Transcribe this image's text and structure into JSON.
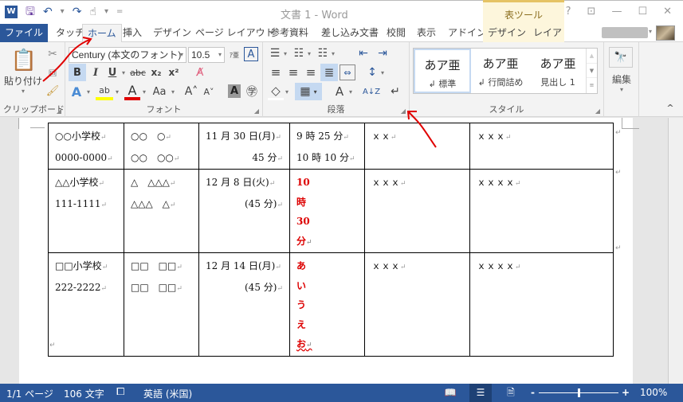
{
  "window": {
    "title": "文書 1 - Word",
    "context_tab_group": "表ツール",
    "controls": {
      "help": "?",
      "ribbon_display": "⊡",
      "minimize": "—",
      "maximize": "☐",
      "close": "✕"
    }
  },
  "qat": {
    "app_icon": "W",
    "save": "🖫",
    "undo": "↶",
    "undo_dd": "▾",
    "redo": "↷",
    "touch": "☝",
    "touch_dd": "▾",
    "customize": "="
  },
  "tabs": [
    {
      "label": "ファイル"
    },
    {
      "label": "タッチ"
    },
    {
      "label": "ホーム",
      "active": true
    },
    {
      "label": "挿入"
    },
    {
      "label": "デザイン"
    },
    {
      "label": "ページ レイアウト"
    },
    {
      "label": "参考資料"
    },
    {
      "label": "差し込み文書"
    },
    {
      "label": "校閲"
    },
    {
      "label": "表示"
    },
    {
      "label": "アドイン"
    },
    {
      "label": "デザイン",
      "context": true
    },
    {
      "label": "レイアウト",
      "context": true
    }
  ],
  "ribbon": {
    "clipboard": {
      "label": "クリップボード",
      "paste": "貼り付け",
      "paste_dd": "▾",
      "cut": "✂",
      "copy": "⧉",
      "format_painter": "🖌"
    },
    "font": {
      "label": "フォント",
      "font_name": "Century (本文のフォント)",
      "font_size": "10.5",
      "phonetic": "ｱ亜",
      "char_border": "A",
      "bold": "B",
      "italic": "I",
      "underline": "U",
      "strike": "abc",
      "subscript": "x₂",
      "superscript": "x²",
      "clear_format": "A̸",
      "text_effect": "A",
      "highlight": "ab",
      "highlight_color": "#ffff00",
      "font_color": "A",
      "font_color_value": "#e00000",
      "change_case": "Aa",
      "grow": "A˄",
      "shrink": "A˅",
      "char_shading": "A",
      "enclose": "㊫"
    },
    "paragraph": {
      "label": "段落",
      "bullets": "☰",
      "numbering": "☷",
      "multilevel": "☷",
      "dec_indent": "⇤",
      "inc_indent": "⇥",
      "align_left": "≡",
      "align_center": "≡",
      "align_right": "≡",
      "justify": "≣",
      "distributed": "⇔",
      "line_spacing": "↕",
      "shading": "◇",
      "borders": "▦",
      "asian_layout": "A",
      "sort": "A↓Z",
      "show_marks": "↵"
    },
    "styles": {
      "label": "スタイル",
      "items": [
        {
          "sample": "あア亜",
          "name": "↲ 標準"
        },
        {
          "sample": "あア亜",
          "name": "↲ 行間詰め"
        },
        {
          "sample": "あア亜",
          "name": "見出し 1"
        }
      ],
      "scroll_up": "▲",
      "scroll_down": "▼",
      "more": "≡"
    },
    "editing": {
      "label": "編集",
      "icon": "🔭",
      "dd": "▾"
    },
    "collapse": "^"
  },
  "table": {
    "rows": [
      {
        "cells": [
          [
            "○○小学校",
            "0000-0000"
          ],
          [
            "○○　○",
            "○○　○○"
          ],
          [
            "11 月 30 日(月)",
            "45 分"
          ],
          [
            "9 時 25 分",
            "10 時 10 分"
          ],
          [
            "ｘｘ"
          ],
          [
            "ｘｘｘ"
          ]
        ]
      },
      {
        "cells": [
          [
            "△△小学校",
            "111-1111"
          ],
          [
            "△　△△△",
            "△△△　△"
          ],
          [
            "12 月 8 日(火)",
            "(45 分)"
          ],
          [
            "10",
            "時",
            "30",
            "分"
          ],
          [
            "ｘｘｘ"
          ],
          [
            "ｘｘｘｘ"
          ]
        ]
      },
      {
        "cells": [
          [
            "□□小学校",
            "222-2222"
          ],
          [
            "□□　□□",
            "□□　□□"
          ],
          [
            "12 月 14 日(月)",
            "(45 分)"
          ],
          [
            "あ",
            "い",
            "う",
            "え",
            "お"
          ],
          [
            "ｘｘｘ"
          ],
          [
            "ｘｘｘｘ"
          ]
        ]
      }
    ],
    "para_mark": "↵"
  },
  "status": {
    "page": "1/1 ページ",
    "words": "106 文字",
    "proof_icon": "⧠",
    "language": "英語 (米国)",
    "zoom_percent": "100%",
    "zoom_minus": "-",
    "zoom_plus": "+",
    "zoom_level": 100
  },
  "annotation_color": "#e00000"
}
